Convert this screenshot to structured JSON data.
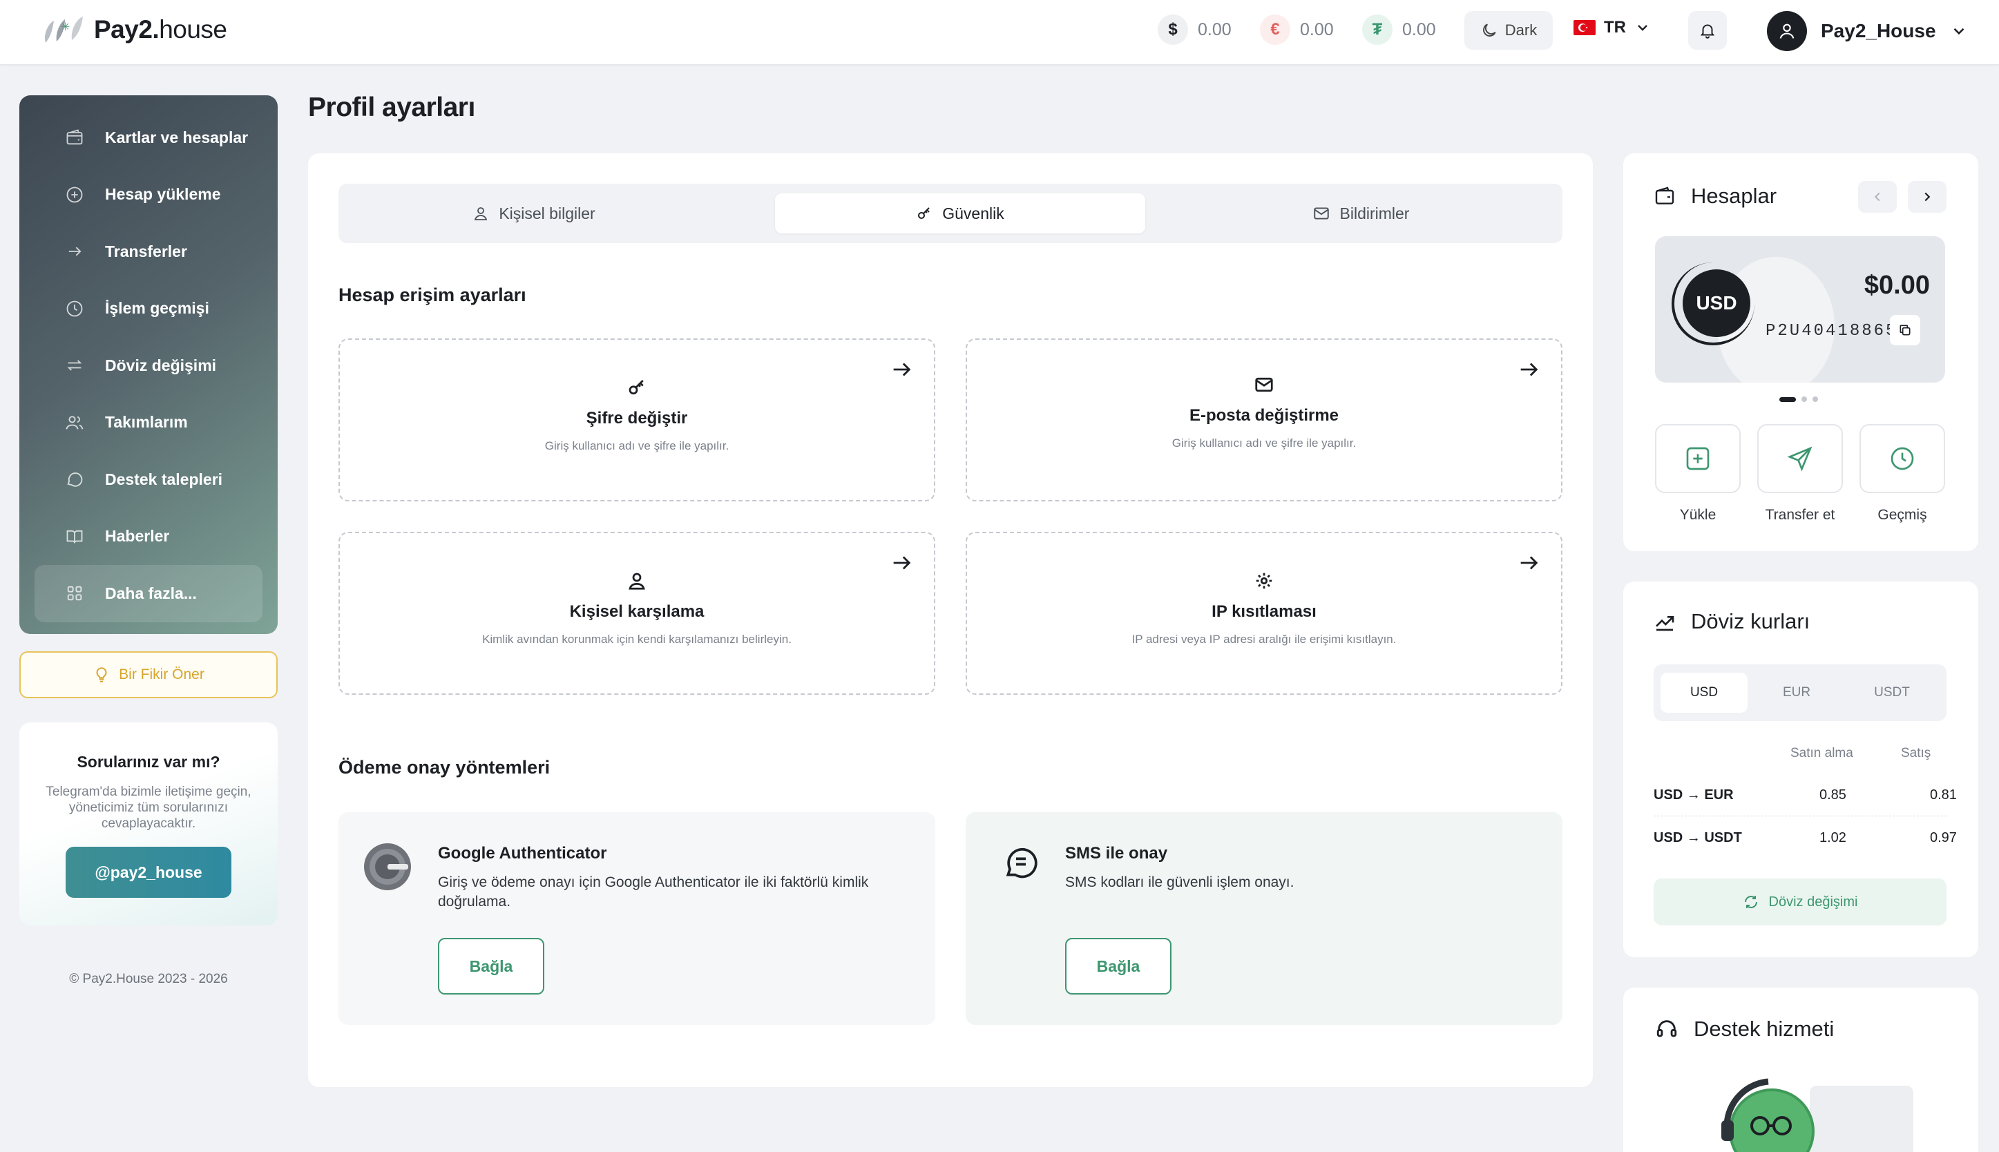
{
  "header": {
    "logo_bold": "Pay2.",
    "logo_rest": "house",
    "balances": [
      {
        "symbol": "$",
        "amount": "0.00",
        "color": "#1c1f24",
        "bg": "#eef0f2"
      },
      {
        "symbol": "€",
        "amount": "0.00",
        "color": "#e0625f",
        "bg": "#fdeeee"
      },
      {
        "symbol": "₮",
        "amount": "0.00",
        "color": "#3d9670",
        "bg": "#e7f4ee"
      }
    ],
    "theme_label": "Dark",
    "language": "TR",
    "username": "Pay2_House"
  },
  "sidebar": {
    "items": [
      {
        "label": "Kartlar ve hesaplar",
        "icon": "wallet-icon"
      },
      {
        "label": "Hesap yükleme",
        "icon": "plus-circle-icon"
      },
      {
        "label": "Transferler",
        "icon": "arrow-right-icon"
      },
      {
        "label": "İşlem geçmişi",
        "icon": "clock-icon"
      },
      {
        "label": "Döviz değişimi",
        "icon": "exchange-icon"
      },
      {
        "label": "Takımlarım",
        "icon": "users-icon"
      },
      {
        "label": "Destek talepleri",
        "icon": "chat-icon"
      },
      {
        "label": "Haberler",
        "icon": "book-icon"
      },
      {
        "label": "Daha fazla...",
        "icon": "grid-icon"
      }
    ],
    "idea_button": "Bir Fikir Öner",
    "help": {
      "title": "Sorularınız var mı?",
      "text": "Telegram'da bizimle iletişime geçin, yöneticimiz tüm sorularınızı cevaplayacaktır.",
      "button": "@pay2_house"
    },
    "copyright": "© Pay2.House 2023 - 2026"
  },
  "main": {
    "title": "Profil ayarları",
    "tabs": [
      {
        "label": "Kişisel bilgiler",
        "icon": "user-icon"
      },
      {
        "label": "Güvenlik",
        "icon": "key-icon"
      },
      {
        "label": "Bildirimler",
        "icon": "mail-icon"
      }
    ],
    "access_section": "Hesap erişim ayarları",
    "options": [
      {
        "title": "Şifre değiştir",
        "desc": "Giriş kullanıcı adı ve şifre ile yapılır.",
        "icon": "key-icon"
      },
      {
        "title": "E-posta değiştirme",
        "desc": "Giriş kullanıcı adı ve şifre ile yapılır.",
        "icon": "mail-icon"
      },
      {
        "title": "Kişisel karşılama",
        "desc": "Kimlik avından korunmak için kendi karşılamanızı belirleyin.",
        "icon": "user-lock-icon"
      },
      {
        "title": "IP kısıtlaması",
        "desc": "IP adresi veya IP adresi aralığı ile erişimi kısıtlayın.",
        "icon": "gear-icon"
      }
    ],
    "payment_section": "Ödeme onay yöntemleri",
    "methods": [
      {
        "title": "Google Authenticator",
        "desc": "Giriş ve ödeme onayı için Google Authenticator ile iki faktörlü kimlik doğrulama.",
        "button": "Bağla",
        "icon": "google-authenticator-icon"
      },
      {
        "title": "SMS ile onay",
        "desc": "SMS kodları ile güvenli işlem onayı.",
        "button": "Bağla",
        "icon": "sms-icon"
      }
    ]
  },
  "accounts": {
    "title": "Hesaplar",
    "currency": "USD",
    "amount": "$0.00",
    "account_number": "P2U40418865",
    "actions": [
      {
        "label": "Yükle",
        "icon": "plus-square-icon"
      },
      {
        "label": "Transfer et",
        "icon": "send-icon"
      },
      {
        "label": "Geçmiş",
        "icon": "clock-icon"
      }
    ]
  },
  "rates": {
    "title": "Döviz kurları",
    "tabs": [
      "USD",
      "EUR",
      "USDT"
    ],
    "buy_label": "Satın alma",
    "sell_label": "Satış",
    "rows": [
      {
        "pair": "USD → EUR",
        "buy": "0.85",
        "sell": "0.81"
      },
      {
        "pair": "USD → USDT",
        "buy": "1.02",
        "sell": "0.97"
      }
    ],
    "exchange_button": "Döviz değişimi"
  },
  "support": {
    "title": "Destek hizmeti"
  },
  "colors": {
    "accent": "#3d9670",
    "dark": "#1c1f24",
    "idea": "#d7a52a"
  }
}
